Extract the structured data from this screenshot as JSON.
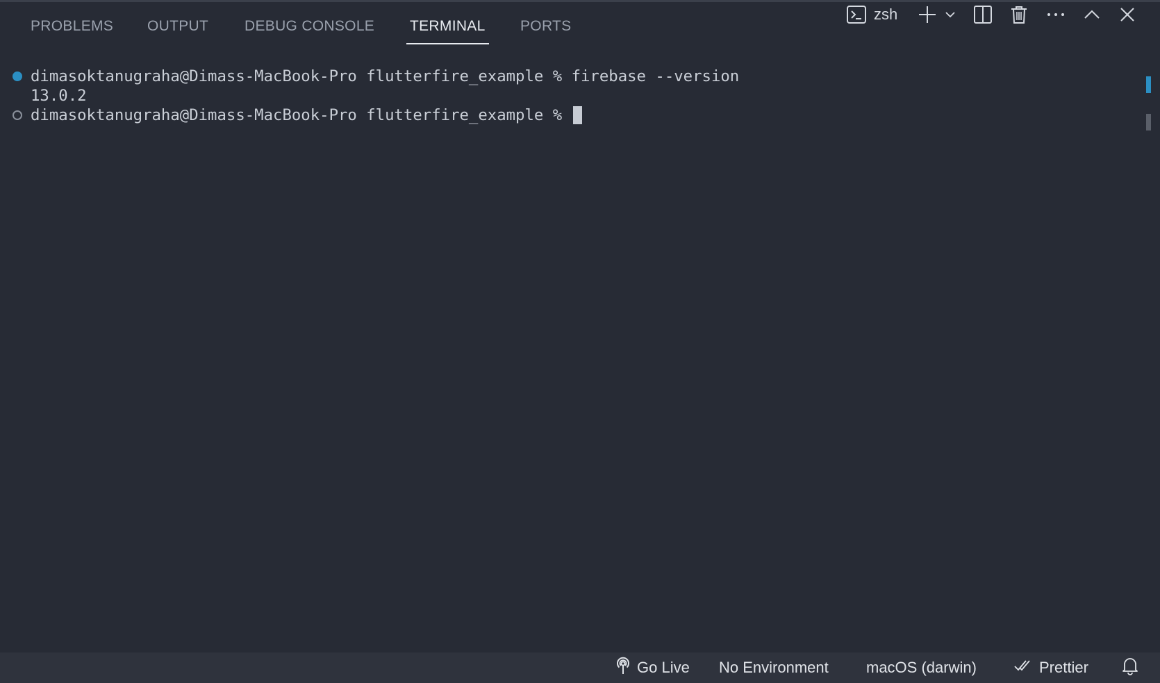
{
  "panel": {
    "tabs": [
      {
        "label": "PROBLEMS",
        "active": false
      },
      {
        "label": "OUTPUT",
        "active": false
      },
      {
        "label": "DEBUG CONSOLE",
        "active": false
      },
      {
        "label": "TERMINAL",
        "active": true
      },
      {
        "label": "PORTS",
        "active": false
      }
    ],
    "actions": {
      "shell_label": "zsh",
      "icons": [
        "terminal-icon",
        "plus-icon",
        "chevron-down-icon",
        "split-icon",
        "trash-icon",
        "more-icon",
        "chevron-up-icon",
        "close-icon"
      ]
    }
  },
  "terminal": {
    "lines": [
      {
        "text": "dimasoktanugraha@Dimass-MacBook-Pro flutterfire_example % firebase --version",
        "decoration": "success"
      },
      {
        "text": "13.0.2",
        "decoration": "none"
      },
      {
        "text": "dimasoktanugraha@Dimass-MacBook-Pro flutterfire_example % ",
        "decoration": "pending"
      }
    ]
  },
  "status_bar": {
    "go_live": "Go Live",
    "environment": "No Environment",
    "os": "macOS (darwin)",
    "prettier": "Prettier"
  },
  "colors": {
    "background": "#272b35",
    "status_bar": "#2f333d",
    "accent_blue": "#2b8fc3",
    "active_tab": "#e8ebf0",
    "inactive_tab": "#9aa1ad"
  }
}
